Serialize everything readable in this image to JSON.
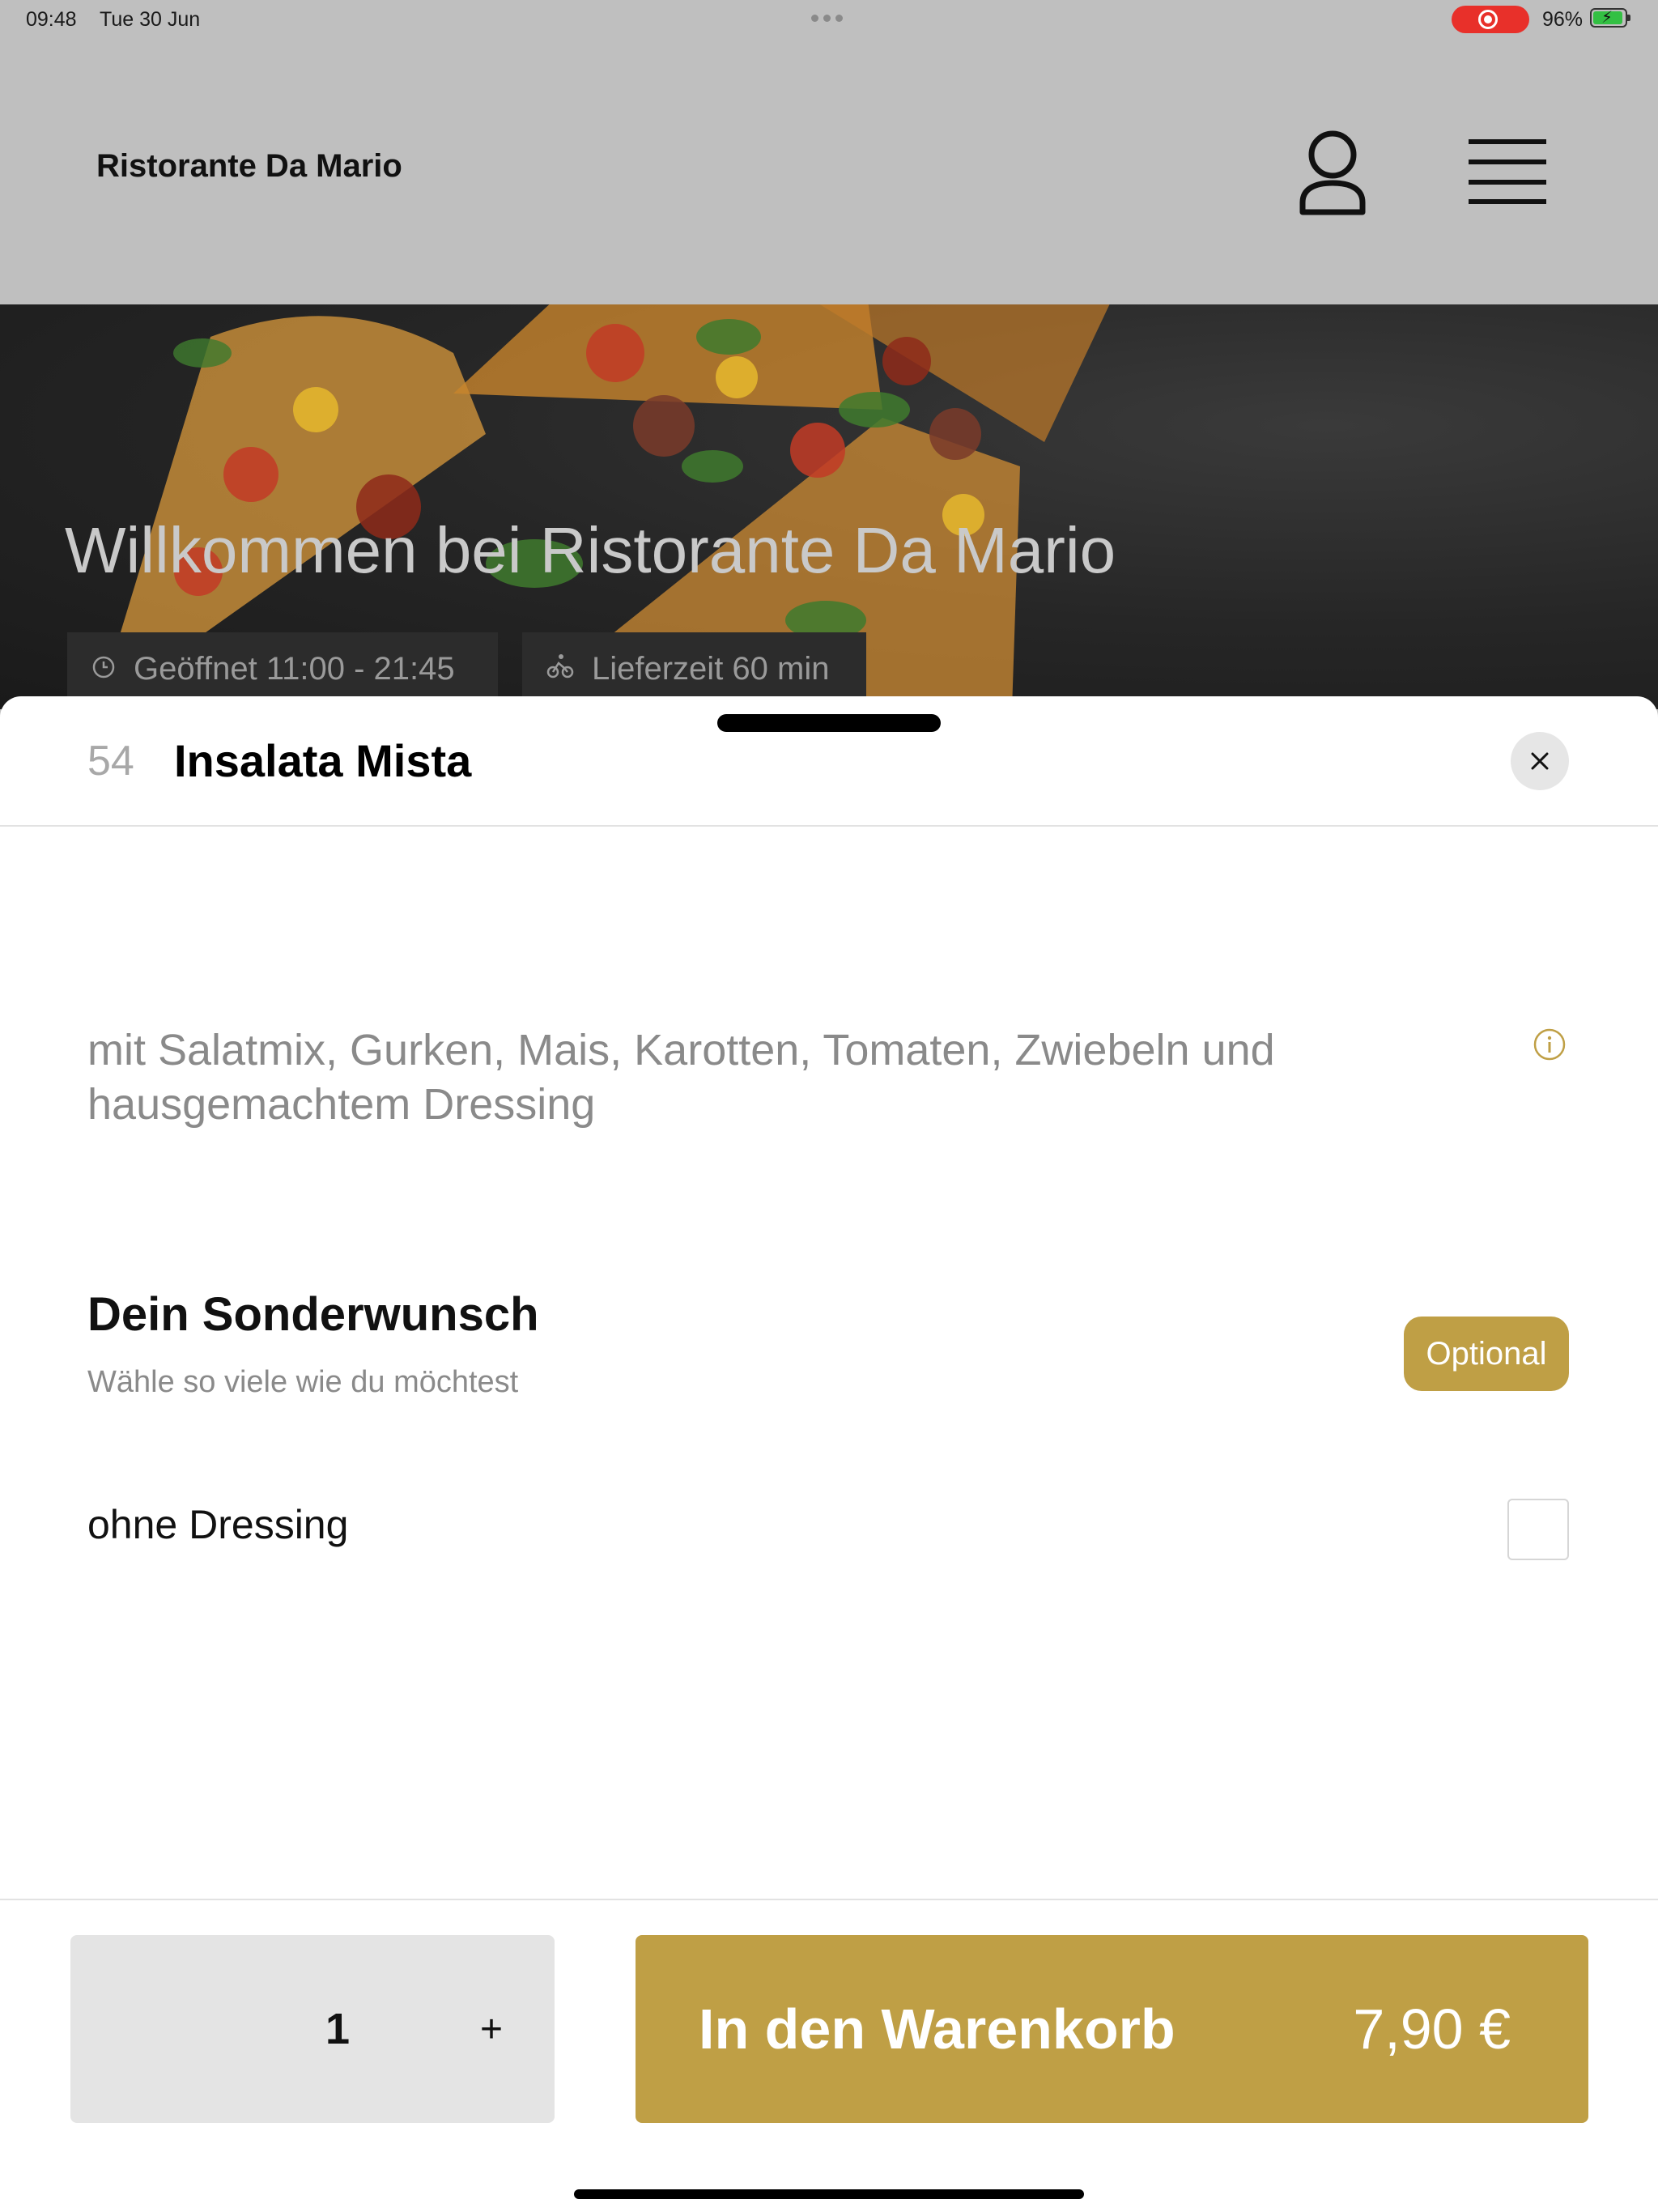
{
  "status_bar": {
    "time": "09:48",
    "date": "Tue 30 Jun",
    "battery_percent": "96%",
    "recording_indicator_icon": "screen-recording-icon",
    "battery_icon": "battery-charging-icon",
    "battery_level": 0.96
  },
  "header": {
    "brand": "Ristorante Da Mario",
    "profile_icon": "user-icon",
    "menu_icon": "hamburger-menu-icon"
  },
  "hero": {
    "title": "Willkommen bei Ristorante Da Mario",
    "opening_hours": "Geöffnet 11:00 - 21:45",
    "delivery_time": "Lieferzeit 60 min",
    "opening_icon": "clock-icon",
    "delivery_icon": "bicycle-icon"
  },
  "item": {
    "number": "54",
    "title": "Insalata Mista",
    "description": "mit Salatmix, Gurken, Mais, Karotten, Tomaten, Zwiebeln und hausgemachtem Dressing",
    "info_icon": "info-icon",
    "close_icon": "close-icon"
  },
  "options": {
    "title": "Dein Sonderwunsch",
    "subtitle": "Wähle so viele wie du möchtest",
    "badge": "Optional",
    "items": [
      {
        "label": "ohne Dressing",
        "checked": false
      }
    ]
  },
  "footer": {
    "quantity": "1",
    "plus": "+",
    "cart_label": "In den Warenkorb",
    "price": "7,90 €"
  },
  "colors": {
    "accent": "#bf9f45",
    "header_bg": "#bfbfbf",
    "qty_bg": "#e4e4e4",
    "record_red": "#e8302a"
  }
}
